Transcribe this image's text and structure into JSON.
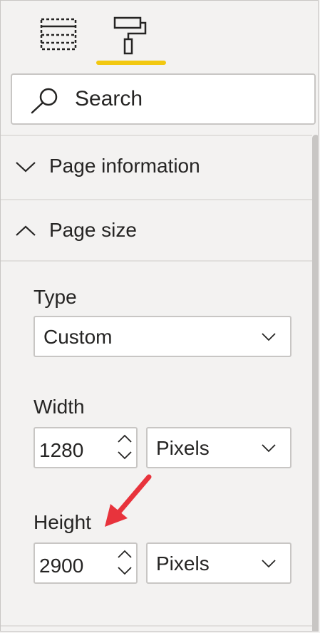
{
  "toolbar": {
    "buttons": [
      {
        "name": "fields",
        "icon": "table-fields-icon",
        "selected": false
      },
      {
        "name": "format",
        "icon": "paint-roller-icon",
        "selected": true
      }
    ],
    "accent_color": "#f2c811"
  },
  "search": {
    "placeholder": "Search",
    "value": "",
    "icon": "search-icon"
  },
  "sections": {
    "page_information": {
      "label": "Page information",
      "expanded": false
    },
    "page_size": {
      "label": "Page size",
      "expanded": true
    }
  },
  "page_size": {
    "type": {
      "label": "Type",
      "value": "Custom"
    },
    "width": {
      "label": "Width",
      "value": "1280",
      "unit": "Pixels"
    },
    "height": {
      "label": "Height",
      "value": "2900",
      "unit": "Pixels"
    }
  },
  "annotation": {
    "icon": "red-arrow-icon",
    "color": "#e8333c"
  }
}
